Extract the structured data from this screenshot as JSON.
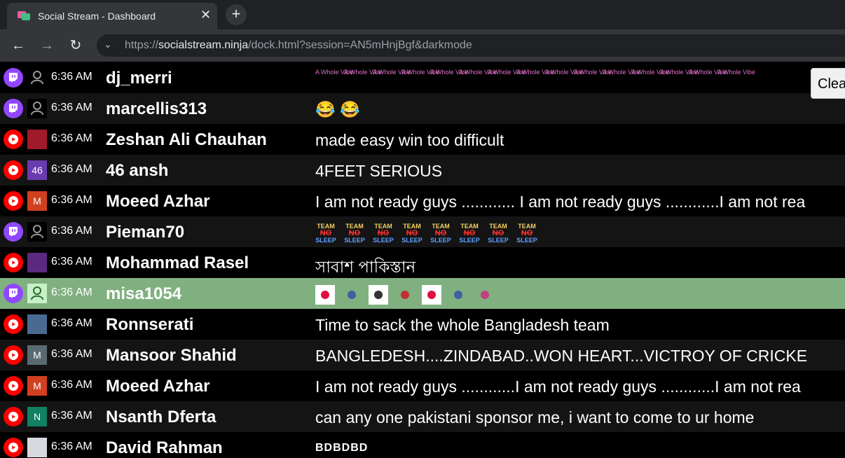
{
  "browser": {
    "tab_title": "Social Stream - Dashboard",
    "new_tab_label": "+",
    "close_label": "✕",
    "url_scheme": "https://",
    "url_host": "socialstream.ninja",
    "url_path": "/dock.html?session=AN5mHnjBgf&darkmode"
  },
  "clear_button": {
    "label": "Clear"
  },
  "emote_text": {
    "whole_vibe": "A Whole Vibe",
    "team": "TEAM",
    "no": "NO",
    "sleep": "SLEEP"
  },
  "messages": [
    {
      "source": "twitch",
      "avatar": "person-icon",
      "time": "6:36 AM",
      "name": "dj_merri",
      "text": ""
    },
    {
      "source": "twitch",
      "avatar": "person-icon",
      "time": "6:36 AM",
      "name": "marcellis313",
      "text": "😂 😂"
    },
    {
      "source": "youtube",
      "avatar": "photo",
      "time": "6:36 AM",
      "name": "Zeshan Ali Chauhan",
      "text": "made easy win too difficult"
    },
    {
      "source": "youtube",
      "avatar": "46",
      "time": "6:36 AM",
      "name": "46 ansh",
      "text": "4FEET SERIOUS"
    },
    {
      "source": "youtube",
      "avatar": "M",
      "time": "6:36 AM",
      "name": "Moeed Azhar",
      "text": "I am not ready guys ............ I am not ready guys ............I am not rea"
    },
    {
      "source": "twitch",
      "avatar": "person-icon",
      "time": "6:36 AM",
      "name": "Pieman70",
      "text": ""
    },
    {
      "source": "youtube",
      "avatar": "photo",
      "time": "6:36 AM",
      "name": "Mohammad Rasel",
      "text": "সাবাশ পাকিস্তান"
    },
    {
      "source": "twitch",
      "avatar": "person-icon",
      "time": "6:36 AM",
      "name": "misa1054",
      "text": ""
    },
    {
      "source": "youtube",
      "avatar": "photo",
      "time": "6:36 AM",
      "name": "Ronnserati",
      "text": "Time to sack the whole Bangladesh team"
    },
    {
      "source": "youtube",
      "avatar": "M",
      "time": "6:36 AM",
      "name": "Mansoor Shahid",
      "text": "BANGLEDESH....ZINDABAD..WON HEART...VICTROY OF CRICKE"
    },
    {
      "source": "youtube",
      "avatar": "M",
      "time": "6:36 AM",
      "name": "Moeed Azhar",
      "text": "I am not ready guys ............I am not ready guys ............I am not rea"
    },
    {
      "source": "youtube",
      "avatar": "N",
      "time": "6:36 AM",
      "name": "Nsanth Dferta",
      "text": "can any one pakistani sponsor me, i want to come to ur home"
    },
    {
      "source": "youtube",
      "avatar": "photo",
      "time": "6:36 AM",
      "name": "David Rahman",
      "text": "BDBDBD"
    }
  ],
  "colors": {
    "twitch": "#9147ff",
    "youtube": "#ff0000",
    "highlight": "#80b080"
  }
}
